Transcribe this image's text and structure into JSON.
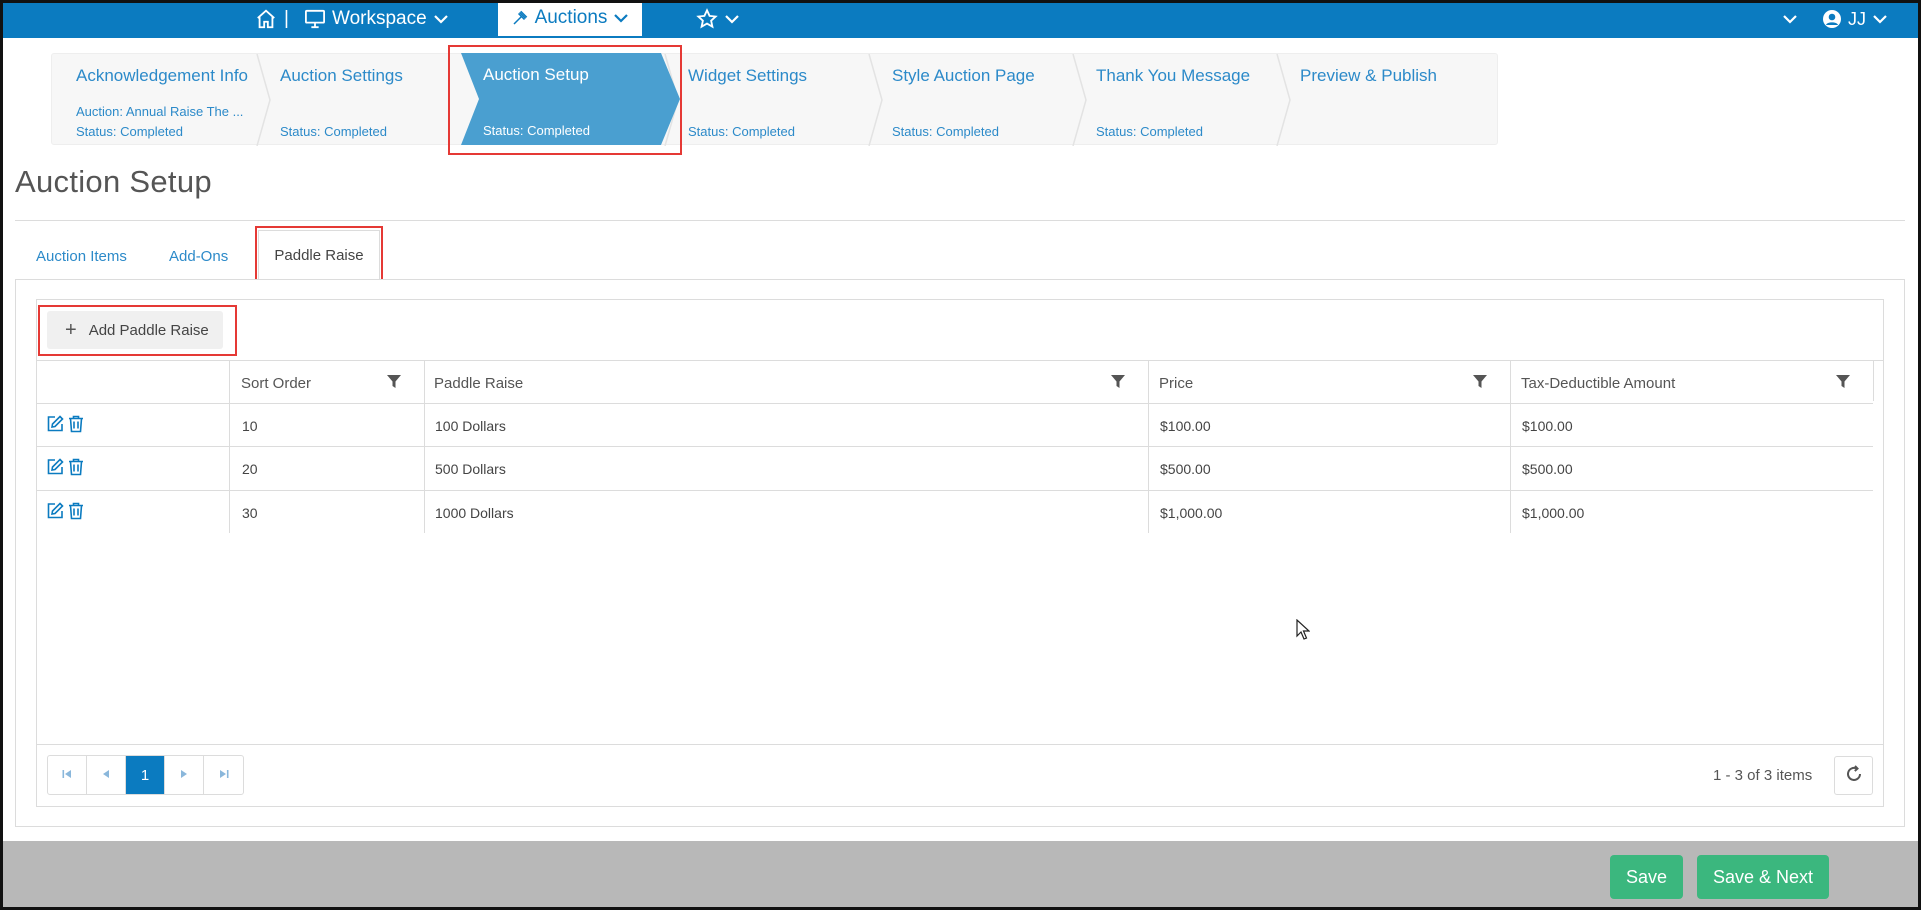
{
  "topbar": {
    "workspace_label": "Workspace",
    "auctions_label": "Auctions",
    "user_initials": "JJ",
    "separator": "|"
  },
  "wizard": {
    "steps": [
      {
        "title": "Acknowledgement Info",
        "subtitle": "Auction: Annual Raise The ...",
        "status": "Status: Completed"
      },
      {
        "title": "Auction Settings",
        "status": "Status: Completed"
      },
      {
        "title": "Auction Setup",
        "status": "Status: Completed",
        "active": true
      },
      {
        "title": "Widget Settings",
        "status": "Status: Completed"
      },
      {
        "title": "Style Auction Page",
        "status": "Status: Completed"
      },
      {
        "title": "Thank You Message",
        "status": "Status: Completed"
      },
      {
        "title": "Preview & Publish"
      }
    ]
  },
  "page": {
    "title": "Auction Setup"
  },
  "tabs": {
    "items": [
      "Auction Items",
      "Add-Ons",
      "Paddle Raise"
    ],
    "active": "Paddle Raise"
  },
  "toolbar": {
    "add_label": "Add Paddle Raise"
  },
  "table": {
    "columns": [
      "Sort Order",
      "Paddle Raise",
      "Price",
      "Tax-Deductible Amount"
    ],
    "rows": [
      {
        "sort_order": "10",
        "paddle_raise": "100 Dollars",
        "price": "$100.00",
        "tax": "$100.00"
      },
      {
        "sort_order": "20",
        "paddle_raise": "500 Dollars",
        "price": "$500.00",
        "tax": "$500.00"
      },
      {
        "sort_order": "30",
        "paddle_raise": "1000 Dollars",
        "price": "$1,000.00",
        "tax": "$1,000.00"
      }
    ]
  },
  "pager": {
    "current_page": "1",
    "info": "1 - 3 of 3 items"
  },
  "footer": {
    "save_label": "Save",
    "save_next_label": "Save & Next"
  },
  "colors": {
    "brand": "#0b7bc0",
    "link": "#2c8ac9",
    "success": "#3bb77e",
    "highlight": "#e53935",
    "footer": "#b8b8b8"
  },
  "icons": [
    "home-icon",
    "monitor-icon",
    "chevron-down-icon",
    "gavel-icon",
    "star-icon",
    "user-circle-icon",
    "plus-icon",
    "filter-icon",
    "edit-icon",
    "trash-icon",
    "first-page-icon",
    "prev-page-icon",
    "next-page-icon",
    "last-page-icon",
    "refresh-icon"
  ]
}
